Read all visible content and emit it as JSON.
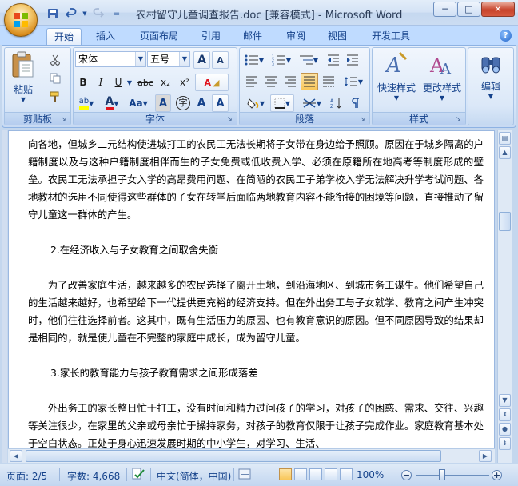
{
  "window": {
    "title": "农村留守儿童调查报告.doc [兼容模式] - Microsoft Word",
    "controls": [
      "─",
      "□",
      "✕"
    ]
  },
  "qat": {
    "dropdown": "="
  },
  "tabs": [
    {
      "label": "开始",
      "active": true
    },
    {
      "label": "插入"
    },
    {
      "label": "页面布局"
    },
    {
      "label": "引用"
    },
    {
      "label": "邮件"
    },
    {
      "label": "审阅"
    },
    {
      "label": "视图"
    },
    {
      "label": "开发工具"
    }
  ],
  "help": "?",
  "ribbon": {
    "clipboard": {
      "paste_label": "粘贴",
      "group_label": "剪贴板"
    },
    "font": {
      "font_name": "宋体",
      "font_size": "五号",
      "grow": "A",
      "shrink": "A",
      "bold": "B",
      "italic": "I",
      "underline": "U",
      "strike": "abc",
      "subscript": "x₂",
      "superscript": "x²",
      "highlight": "ab",
      "font_color": "A",
      "change_case": "Aa",
      "char_shading": "A",
      "enclose": "字",
      "phonetic": "A",
      "border_char": "A",
      "clear_fmt": "A",
      "group_label": "字体"
    },
    "paragraph": {
      "group_label": "段落"
    },
    "styles": {
      "quick_styles": "快速样式",
      "change_styles": "更改样式",
      "group_label": "样式"
    },
    "editing": {
      "label": "编辑"
    },
    "colors": {
      "highlight": "#ffff00",
      "font_red": "#e0141e",
      "accent": "#15428b"
    }
  },
  "document": {
    "p1": "向各地，但城乡二元结构使进城打工的农民工无法长期将子女带在身边给予照顾。原因在于城乡隔离的户籍制度以及与这种户籍制度相伴而生的子女免费或低收费入学、必须在原籍所在地高考等制度形成的壁垒。农民工无法承担子女入学的高昂费用问题、在简陋的农民工子弟学校入学无法解决升学考试问题、各地教材的选用不同使得这些群体的子女在转学后面临两地教育内容不能衔接的困境等问题，直接推动了留守儿童这一群体的产生。",
    "h2": "2.在经济收入与子女教育之间取舍失衡",
    "p2": "为了改善家庭生活，越来越多的农民选择了离开土地，到沿海地区、到城市务工谋生。他们希望自己的生活越来越好，也希望给下一代提供更充裕的经济支持。但在外出务工与子女就学、教育之间产生冲突时，他们往往选择前者。这其中，既有生活压力的原因、也有教育意识的原因。但不同原因导致的结果却是相同的，就是使儿童在不完整的家庭中成长，成为留守儿童。",
    "h3": "3.家长的教育能力与孩子教育需求之间形成落差",
    "p3": "外出务工的家长整日忙于打工，没有时间和精力过问孩子的学习，对孩子的困惑、需求、交往、兴趣等关注很少，在家里的父亲或母亲忙于操持家务，对孩子的教育仅限于让孩子完成作业。家庭教育基本处于空白状态。正处于身心迅速发展时期的中小学生，对学习、生活、"
  },
  "status": {
    "page": "页面: 2/5",
    "words": "字数: 4,668",
    "language": "中文(简体，中国)",
    "zoom": "100%",
    "zoom_minus": "−",
    "zoom_plus": "+"
  }
}
